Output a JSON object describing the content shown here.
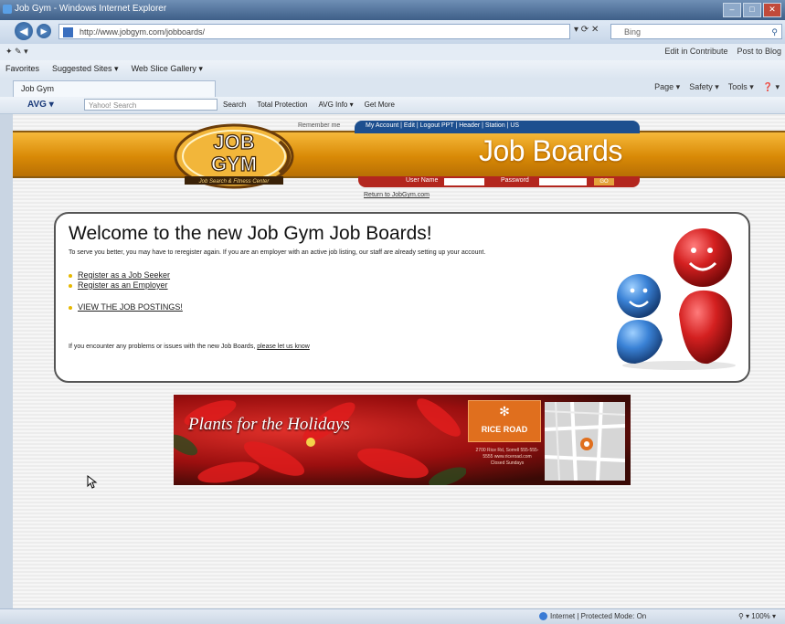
{
  "window": {
    "title": "Job Gym - Windows Internet Explorer",
    "controls": [
      "–",
      "□",
      "✕"
    ]
  },
  "address_bar": {
    "url": "http://www.jobgym.com/jobboards/",
    "search_placeholder": "Bing",
    "nav_back": "◀",
    "nav_forward": "▶",
    "controls": "▾ ⟳ ✕"
  },
  "menu_row": {
    "left": "✦ ✎ ▾",
    "right": [
      "Edit in Contribute",
      "Post to Blog"
    ]
  },
  "favorites_bar": {
    "items": [
      "Favorites",
      "Suggested Sites ▾",
      "Web Slice Gallery ▾"
    ]
  },
  "tab": {
    "label": "Job Gym",
    "tools": [
      "Page ▾",
      "Safety ▾",
      "Tools ▾",
      "❓ ▾"
    ]
  },
  "avg_toolbar": {
    "brand": "AVG ▾",
    "search_placeholder": "Yahoo! Search",
    "tools": [
      "Search",
      "Total Protection",
      "AVG Info ▾",
      "Get More"
    ]
  },
  "site": {
    "remember": "Remember me",
    "top_links": "My Account | Edit | Logout      PPT | Header | Station | US",
    "header_title": "Job Boards",
    "login": {
      "username_label": "User Name",
      "password_label": "Password",
      "go": "GO"
    },
    "return_link": "Return to JobGym.com",
    "logo": {
      "line1": "JOB",
      "line2": "GYM",
      "tagline": "Job Search & Fitness Center"
    }
  },
  "welcome": {
    "heading": "Welcome to the new Job Gym Job Boards!",
    "intro": "To serve you better, you may have to reregister again. If you are an employer with an active job listing, our staff are already setting up your account.",
    "links": [
      "Register as a Job Seeker",
      "Register as an Employer",
      "VIEW THE JOB POSTINGS!"
    ],
    "footer_text": "If you encounter any problems or issues with the new Job Boards, ",
    "footer_link": "please let us know"
  },
  "banner": {
    "tagline": "Plants for the Holidays",
    "brand": "RICE ROAD",
    "address": "2700 Rice Rd, Sorrell  555-555-5555  www.riceroad.com  Closed Sundays"
  },
  "status_bar": {
    "zone": "Internet | Protected Mode: On",
    "zoom": "⚲ ▾   100% ▾"
  },
  "colors": {
    "header_orange": "#d98a06",
    "header_blue": "#1d4f8f",
    "login_red": "#b3261e",
    "smiley_blue": "#3a82d6",
    "smiley_red": "#cc2222"
  }
}
